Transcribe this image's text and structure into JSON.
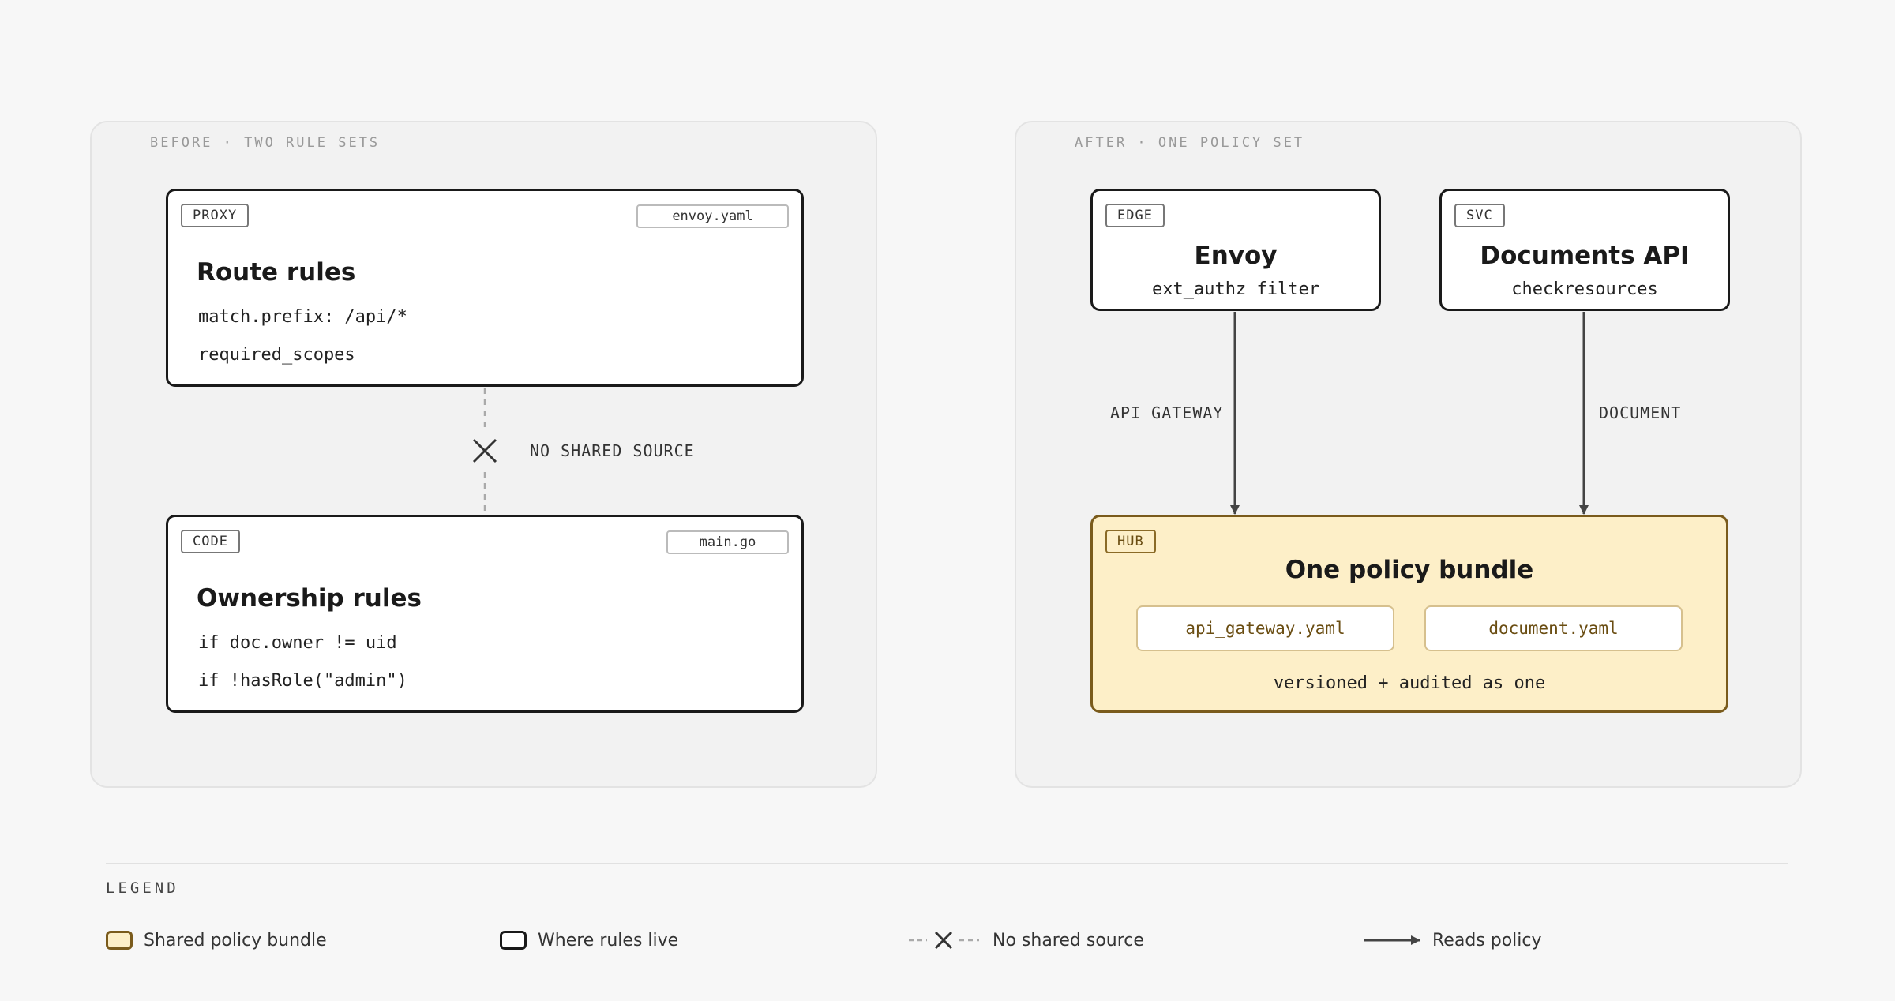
{
  "before": {
    "title": "BEFORE · TWO RULE SETS",
    "proxy_card": {
      "tag": "PROXY",
      "file": "envoy.yaml",
      "title": "Route rules",
      "lines": [
        "match.prefix: /api/*",
        "required_scopes"
      ]
    },
    "code_card": {
      "tag": "CODE",
      "file": "main.go",
      "title": "Ownership rules",
      "lines": [
        "if doc.owner != uid",
        "if !hasRole(\"admin\")"
      ]
    },
    "connector_label": "NO SHARED SOURCE"
  },
  "after": {
    "title": "AFTER · ONE POLICY SET",
    "edge_card": {
      "tag": "EDGE",
      "title": "Envoy",
      "subtitle": "ext_authz filter"
    },
    "svc_card": {
      "tag": "SVC",
      "title": "Documents API",
      "subtitle": "checkresources"
    },
    "edge_arrow_label": "API_GATEWAY",
    "svc_arrow_label": "DOCUMENT",
    "hub": {
      "tag": "HUB",
      "title": "One policy bundle",
      "files": [
        "api_gateway.yaml",
        "document.yaml"
      ],
      "footer": "versioned + audited as one"
    }
  },
  "legend": {
    "title": "LEGEND",
    "items": [
      {
        "label": "Shared policy bundle",
        "icon": "bundle-swatch-icon"
      },
      {
        "label": "Where rules live",
        "icon": "rule-box-swatch-icon"
      },
      {
        "label": "No shared source",
        "icon": "dashed-cross-icon"
      },
      {
        "label": "Reads policy",
        "icon": "arrow-icon"
      }
    ]
  },
  "colors": {
    "background": "#f7f7f7",
    "panel": "#f2f2f2",
    "hub_fill": "#fdefc8",
    "hub_border": "#7a5b1c",
    "ink": "#1a1a1a"
  }
}
